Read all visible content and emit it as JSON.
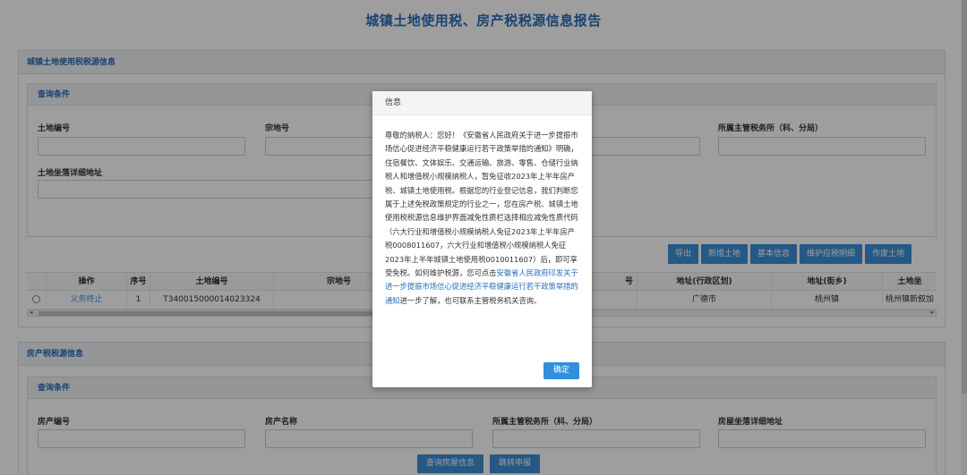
{
  "page": {
    "title": "城镇土地使用税、房产税税源信息报告"
  },
  "land_section": {
    "title": "城镇土地使用税税源信息",
    "query": {
      "title": "查询条件",
      "fields": {
        "land_no": "土地编号",
        "parcel_no": "宗地号",
        "tax_office": "所属主管税务所（科、分局）",
        "address": "土地坐落详细地址"
      }
    },
    "toolbar": [
      "导出",
      "新增土地",
      "基本信息",
      "维护应税明细",
      "作废土地"
    ],
    "table": {
      "headers": {
        "op": "操作",
        "seq": "序号",
        "land_no": "土地编号",
        "parcel_no": "宗地号",
        "hidden_suffix": "号",
        "district": "地址(行政区划)",
        "street": "地址(街乡)",
        "land_loc": "土地坐"
      },
      "row": {
        "op": "义务终止",
        "seq": "1",
        "land_no": "T340015000014023324",
        "district": "广德市",
        "street": "桃州镇",
        "land_loc": "桃州镇新叙加"
      }
    }
  },
  "house_section": {
    "title": "房产税税源信息",
    "query": {
      "title": "查询条件",
      "fields": {
        "house_no": "房产编号",
        "house_name": "房产名称",
        "tax_office": "所属主管税务所（科、分局）",
        "address": "房屋坐落详细地址"
      }
    },
    "buttons": {
      "query": "查询房屋信息",
      "jump": "跳转申报"
    }
  },
  "modal": {
    "title": "信息",
    "body_before": "尊敬的纳税人：您好！《安徽省人民政府关于进一步提振市场信心促进经济平稳健康运行若干政策举措的通知》明确，住宿餐饮、文体娱乐、交通运输、旅游、零售、仓储行业纳税人和增值税小规模纳税人，暂免征收2023年上半年房产税、城镇土地使用税。根据您的行业登记信息，我们判断您属于上述免税政策规定的行业之一，您在房产税、城镇土地使用税税源信息维护界面减免性质栏选择相应减免性质代码（六大行业和增值税小规模纳税人免征2023年上半年房产税0008011607，六大行业和增值税小规模纳税人免征2023年上半年城镇土地使用税0010011607）后，即可享受免税。如何维护税源，您可点击",
    "link_text": "安徽省人民政府印发关于进一步提振市场信心促进经济平稳健康运行若干政策举措的通知",
    "body_after": "进一步了解，也可联系主管税务机关咨询。",
    "ok_label": "确定"
  }
}
